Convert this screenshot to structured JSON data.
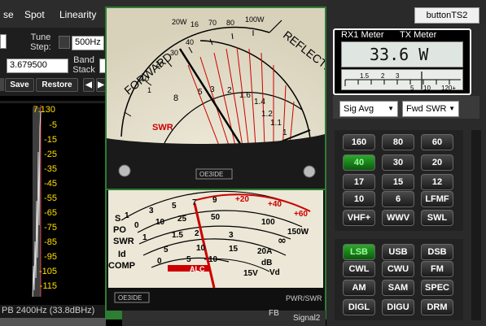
{
  "menu": {
    "items": [
      "se",
      "Spot",
      "Linearity"
    ]
  },
  "button_ts2": "buttonTS2",
  "left": {
    "tune_step_label": "Tune\nStep:",
    "tune_step_value": "500Hz",
    "band_stack_label": "Band\nStack",
    "frequency": "3.679500",
    "save_label": "Save",
    "restore_label": "Restore",
    "scale_labels": [
      "7.130",
      "-5",
      "-15",
      "-25",
      "-35",
      "-45",
      "-55",
      "-65",
      "-75",
      "-85",
      "-95",
      "-105",
      "-115"
    ],
    "status": "PB 2400Hz (33.8dBHz)"
  },
  "meter": {
    "forward_label": "FORWARD",
    "reflected_label": "REFLECTED",
    "swr_label": "SWR",
    "brand": "OE3IDE",
    "pwr_scale": [
      "20W",
      "16",
      "70",
      "80",
      "100W"
    ],
    "fwd_scale": [
      "1",
      "10",
      "20",
      "30",
      "40"
    ],
    "swr_scale": [
      "8",
      "5",
      "3",
      "2",
      "1.6",
      "1.4",
      "1.2",
      "1.1",
      "1"
    ],
    "s_scale": [
      "1",
      "3",
      "5",
      "7",
      "9",
      "+20",
      "+40",
      "+60"
    ],
    "po_scale": [
      "0",
      "10",
      "25",
      "50",
      "100",
      "150W"
    ],
    "swr_bottom": [
      "1",
      "1.5",
      "2",
      "3",
      "∞"
    ],
    "id_scale": [
      "5",
      "10",
      "15",
      "20A"
    ],
    "comp_scale": [
      "0",
      "5",
      "10",
      "dB"
    ],
    "labels": {
      "s": "S",
      "po": "PO",
      "swr": "SWR",
      "id": "Id",
      "comp": "COMP",
      "alc": "ALC",
      "vd": "Vd",
      "v15": "15V"
    },
    "caption": "PWR/SWR",
    "brand2": "OE3IDE",
    "tab_fb": "FB",
    "tab_signal2": "Signal2"
  },
  "right": {
    "rx1_label": "RX1 Meter",
    "tx_label": "TX Meter",
    "readout": "33.6 W",
    "scale": [
      "1.5",
      "2",
      "3",
      "5",
      "10",
      "120+"
    ],
    "sig_select": "Sig Avg",
    "fwd_select": "Fwd SWR",
    "bands": [
      "160",
      "80",
      "60",
      "40",
      "30",
      "20",
      "17",
      "15",
      "12",
      "10",
      "6",
      "LFMF",
      "VHF+",
      "WWV",
      "SWL"
    ],
    "active_band": "40",
    "modes": [
      "LSB",
      "USB",
      "DSB",
      "CWL",
      "CWU",
      "FM",
      "AM",
      "SAM",
      "SPEC",
      "DIGL",
      "DIGU",
      "DRM"
    ],
    "active_mode": "LSB"
  },
  "colors": {
    "active_green": "#2ea82e",
    "meter_bg": "#ebe6d4",
    "needle": "#000",
    "scale_red": "#cc0000",
    "readout_bg": "#dfe5e0"
  }
}
